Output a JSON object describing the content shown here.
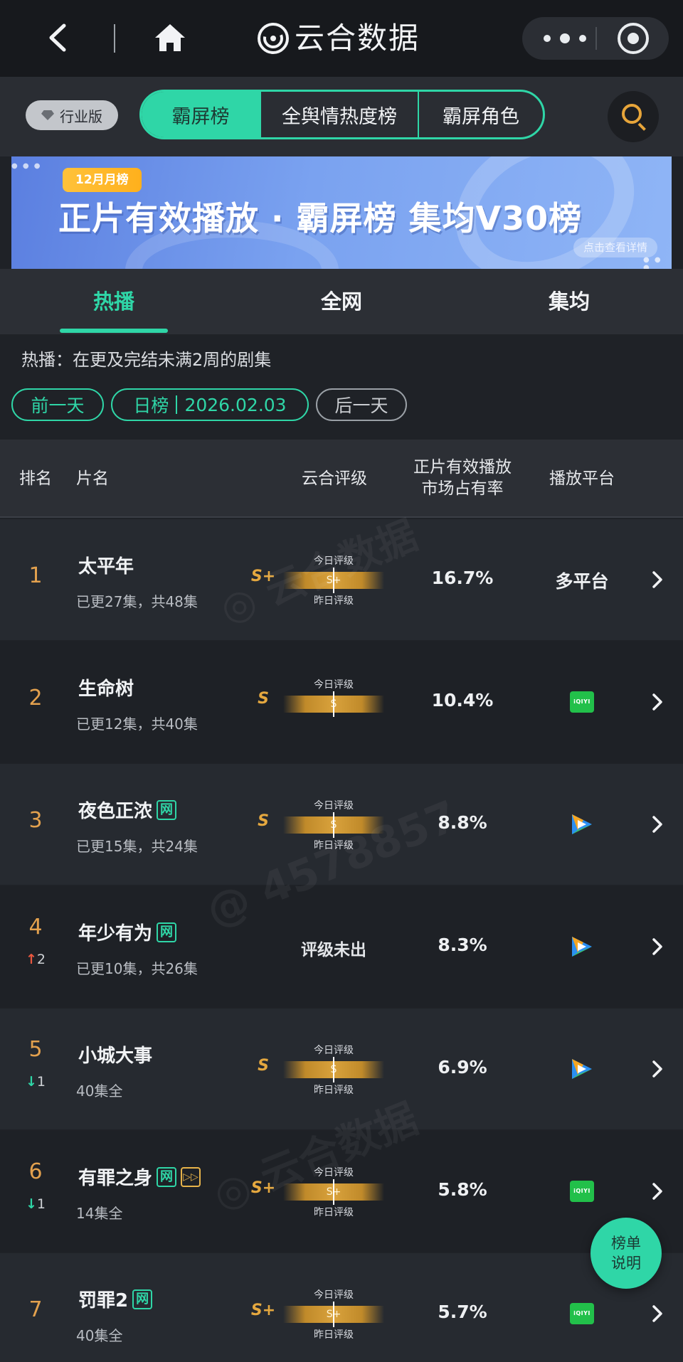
{
  "nav": {
    "app_title": "云合数据",
    "icons": [
      "back-icon",
      "home-icon",
      "yunhe-logo-icon",
      "more-dots-icon",
      "target-icon"
    ]
  },
  "header": {
    "industry_pill": "行业版",
    "segment_tabs": [
      "霸屏榜",
      "全舆情热度榜",
      "霸屏角色"
    ],
    "active_segment": "霸屏榜"
  },
  "banner": {
    "month_tag": "12月月榜",
    "title": "正片有效播放 · 霸屏榜 集均V30榜",
    "detail_link": "点击查看详情"
  },
  "subtabs": {
    "items": [
      "热播",
      "全网",
      "集均"
    ],
    "active": "热播"
  },
  "filters": {
    "description": "热播：在更及完结未满2周的剧集",
    "prev_day": "前一天",
    "day_list": "日榜",
    "date": "2026.02.03",
    "next_day": "后一天"
  },
  "table": {
    "headers": {
      "rank": "排名",
      "title": "片名",
      "rating": "云合评级",
      "share_line1": "正片有效播放",
      "share_line2": "市场占有率",
      "platform": "播放平台"
    },
    "rating_today_label": "今日评级",
    "rating_yesterday_label": "昨日评级",
    "rows": [
      {
        "rank": "1",
        "change": "",
        "title": "太平年",
        "badges": [],
        "episodes": "已更27集，共48集",
        "grade": "S+",
        "today": "S+",
        "show_yesterday": true,
        "share": "16.7%",
        "platform": "多平台"
      },
      {
        "rank": "2",
        "change": "",
        "title": "生命树",
        "badges": [],
        "episodes": "已更12集，共40集",
        "grade": "S",
        "today": "S",
        "show_yesterday": false,
        "share": "10.4%",
        "platform": "iqiyi"
      },
      {
        "rank": "3",
        "change": "",
        "title": "夜色正浓",
        "badges": [
          "网"
        ],
        "episodes": "已更15集，共24集",
        "grade": "S",
        "today": "S",
        "show_yesterday": true,
        "share": "8.8%",
        "platform": "tencent"
      },
      {
        "rank": "4",
        "change": "2",
        "change_dir": "up",
        "title": "年少有为",
        "badges": [
          "网"
        ],
        "episodes": "已更10集，共26集",
        "grade": "",
        "no_rating": "评级未出",
        "share": "8.3%",
        "platform": "tencent"
      },
      {
        "rank": "5",
        "change": "1",
        "change_dir": "down",
        "title": "小城大事",
        "badges": [],
        "episodes": "40集全",
        "grade": "S",
        "today": "S",
        "show_yesterday": true,
        "share": "6.9%",
        "platform": "tencent"
      },
      {
        "rank": "6",
        "change": "1",
        "change_dir": "down",
        "title": "有罪之身",
        "badges": [
          "网",
          "play"
        ],
        "episodes": "14集全",
        "grade": "S+",
        "today": "S+",
        "show_yesterday": true,
        "share": "5.8%",
        "platform": "iqiyi"
      },
      {
        "rank": "7",
        "change": "",
        "title": "罚罪2",
        "badges": [
          "网"
        ],
        "episodes": "40集全",
        "grade": "S+",
        "today": "S+",
        "show_yesterday": true,
        "share": "5.7%",
        "platform": "iqiyi"
      }
    ]
  },
  "platform_labels": {
    "iqiyi": "iQIYI"
  },
  "help_button": {
    "line1": "榜单",
    "line2": "说明"
  },
  "colors": {
    "accent": "#2fd6a7",
    "gold": "#e5a83f",
    "background": "#1f2227"
  }
}
